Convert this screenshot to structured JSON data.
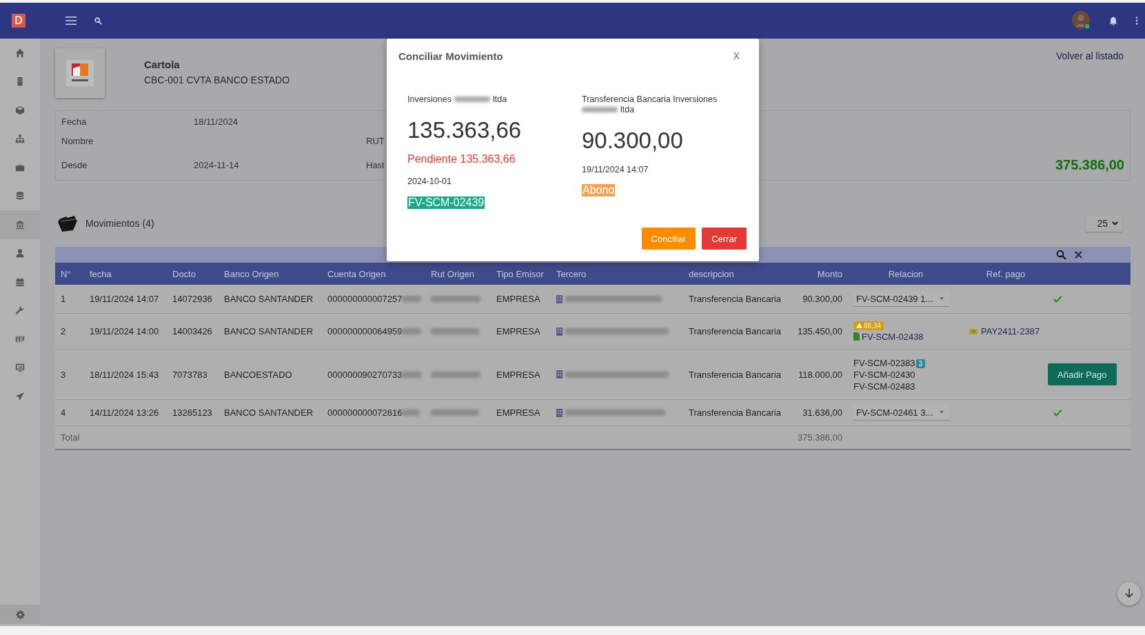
{
  "app": {
    "logo_letter": "D"
  },
  "sidebar": {
    "items": [
      {
        "kind": "home",
        "selected": false
      },
      {
        "kind": "building",
        "selected": false
      },
      {
        "kind": "cube",
        "selected": false
      },
      {
        "kind": "sitemap",
        "selected": false
      },
      {
        "kind": "briefcase",
        "selected": false
      },
      {
        "kind": "coins",
        "selected": false
      },
      {
        "kind": "bank",
        "selected": true
      },
      {
        "kind": "user",
        "selected": false
      },
      {
        "kind": "calendar",
        "selected": false
      },
      {
        "kind": "wrench",
        "selected": false
      },
      {
        "kind": "barcode",
        "selected": false
      },
      {
        "kind": "chart",
        "selected": false
      },
      {
        "kind": "plane",
        "selected": false
      }
    ]
  },
  "page": {
    "title": "Cartola",
    "subtitle": "CBC-001 CVTA BANCO ESTADO",
    "back_link": "Volver al listado"
  },
  "info": {
    "rows": [
      {
        "label": "Fecha",
        "value": "18/11/2024"
      },
      {
        "label": "Nombre",
        "label_2": "RUT"
      },
      {
        "label": "Desde",
        "value": "2024-11-14",
        "label_2": "Hast",
        "total": "375.386,00"
      }
    ]
  },
  "movements": {
    "title": "Movimientos (4)",
    "page_size": "25",
    "columns": [
      "N°",
      "fecha",
      "Docto",
      "Banco Origen",
      "Cuenta Origen",
      "Rut Origen",
      "Tipo Emisor",
      "Tercero",
      "descripcion",
      "Monto",
      "Relacion",
      "Ref. pago"
    ],
    "rows": [
      {
        "n": "1",
        "fecha": "19/11/2024 14:07",
        "docto": "14072936",
        "banco": "BANCO SANTANDER",
        "cuenta": "000000000007257",
        "tipo": "EMPRESA",
        "descripcion": "Transferencia Bancaria",
        "monto": "90.300,00",
        "relacion": {
          "kind": "select",
          "value": "FV-SCM-02439 1..."
        },
        "action": {
          "kind": "check"
        }
      },
      {
        "n": "2",
        "fecha": "19/11/2024 14:00",
        "docto": "14003426",
        "banco": "BANCO SANTANDER",
        "cuenta": "000000000064959",
        "tipo": "EMPRESA",
        "descripcion": "Transferencia Bancaria",
        "monto": "135.450,00",
        "relacion": {
          "kind": "warning",
          "badge": "88,34",
          "invoice": "FV-SCM-02438"
        },
        "ref": "PAY2411-2387"
      },
      {
        "n": "3",
        "fecha": "18/11/2024 15:43",
        "docto": "7073783",
        "banco": "BANCOESTADO",
        "cuenta": "000000090270733",
        "tipo": "EMPRESA",
        "descripcion": "Transferencia Bancaria",
        "monto": "118.000,00",
        "relacion": {
          "kind": "list",
          "items": [
            "FV-SCM-02383",
            "FV-SCM-02430",
            "FV-SCM-02483"
          ],
          "count": "3"
        },
        "action": {
          "kind": "button",
          "label": "Añadir Pago"
        }
      },
      {
        "n": "4",
        "fecha": "14/11/2024 13:26",
        "docto": "13265123",
        "banco": "BANCO SANTANDER",
        "cuenta": "000000000072616",
        "tipo": "EMPRESA",
        "descripcion": "Transferencia Bancaria",
        "monto": "31.636,00",
        "relacion": {
          "kind": "select",
          "value": "FV-SCM-02461 3..."
        },
        "action": {
          "kind": "check"
        }
      }
    ],
    "total_label": "Total",
    "total_amount": "375.386,00"
  },
  "modal": {
    "title": "Conciliar Movimiento",
    "close": "X",
    "left": {
      "name_start": "Inversiones",
      "name_end": "ltda",
      "amount": "135.363,66",
      "pending": "Pendiente 135.363,66",
      "date": "2024-10-01",
      "tag": "FV-SCM-02439"
    },
    "right": {
      "name_start": "Transferencia Bancaria Inversiones",
      "name_end": "ltda",
      "amount": "90.300,00",
      "date": "19/11/2024 14:07",
      "tag": "Abono"
    },
    "buttons": [
      {
        "kind": "confirm",
        "label": "Conciliar"
      },
      {
        "kind": "cancel",
        "label": "Cerrar"
      }
    ]
  }
}
